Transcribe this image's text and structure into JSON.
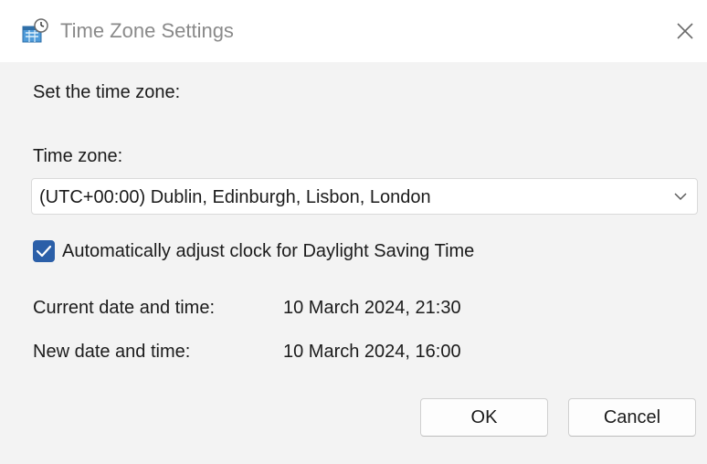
{
  "window": {
    "title": "Time Zone Settings",
    "icon": "clock-globe-icon",
    "close_icon": "close-icon"
  },
  "content": {
    "heading": "Set the time zone:",
    "timezone_label": "Time zone:",
    "timezone_selected": "(UTC+00:00) Dublin, Edinburgh, Lisbon, London",
    "dst_checkbox_label": "Automatically adjust clock for Daylight Saving Time",
    "dst_checked": true,
    "current_label": "Current date and time:",
    "current_value": "10 March 2024, 21:30",
    "new_label": "New date and time:",
    "new_value": "10 March 2024, 16:00"
  },
  "buttons": {
    "ok": "OK",
    "cancel": "Cancel"
  },
  "colors": {
    "accent": "#2b5fa8",
    "content_bg": "#f3f3f3",
    "title_text": "#8a8a8a"
  }
}
